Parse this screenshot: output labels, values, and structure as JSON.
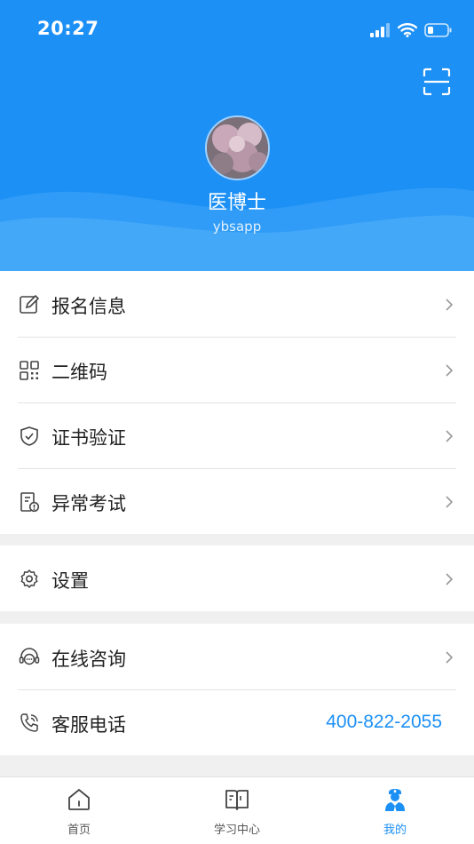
{
  "status_bar": {
    "time": "20:27"
  },
  "profile": {
    "name": "医博士",
    "account": "ybsapp"
  },
  "menu_group_1": [
    {
      "label": "报名信息",
      "icon": "edit-form-icon"
    },
    {
      "label": "二维码",
      "icon": "qr-code-icon"
    },
    {
      "label": "证书验证",
      "icon": "shield-check-icon"
    },
    {
      "label": "异常考试",
      "icon": "exam-alert-icon"
    }
  ],
  "menu_group_2": [
    {
      "label": "设置",
      "icon": "gear-icon"
    }
  ],
  "menu_group_3": [
    {
      "label": "在线咨询",
      "icon": "headset-chat-icon"
    },
    {
      "label": "客服电话",
      "icon": "phone-icon",
      "value": "400-822-2055"
    }
  ],
  "tabbar": [
    {
      "label": "首页",
      "icon": "home-icon",
      "active": false
    },
    {
      "label": "学习中心",
      "icon": "book-icon",
      "active": false
    },
    {
      "label": "我的",
      "icon": "doctor-user-icon",
      "active": true
    }
  ],
  "colors": {
    "primary": "#1d90f5",
    "text": "#222222",
    "background": "#f0f0f0"
  }
}
